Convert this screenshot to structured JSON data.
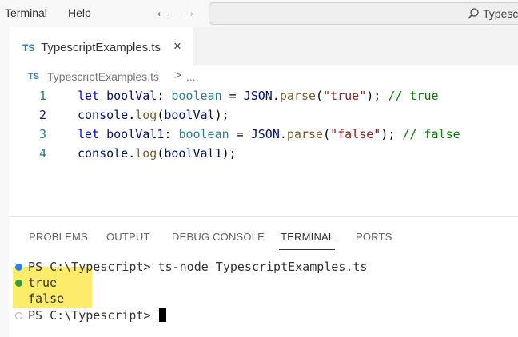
{
  "menu": {
    "terminal": "Terminal",
    "help": "Help"
  },
  "navigation": {
    "back_icon": "arrow-left-icon",
    "forward_icon": "arrow-right-icon"
  },
  "search": {
    "text": "Typesc",
    "icon": "search-icon"
  },
  "editor": {
    "tab": {
      "badge": "TS",
      "label": "TypescriptExamples.ts",
      "close": "×"
    },
    "breadcrumb": {
      "badge": "TS",
      "file": "TypescriptExamples.ts",
      "separator": ">",
      "more": "..."
    },
    "lines": [
      {
        "number": "1",
        "tokens": [
          {
            "text": "let",
            "kind": "kw"
          },
          {
            "text": " ",
            "kind": "plain"
          },
          {
            "text": "boolVal",
            "kind": "var"
          },
          {
            "text": ": ",
            "kind": "plain"
          },
          {
            "text": "boolean",
            "kind": "type"
          },
          {
            "text": " = ",
            "kind": "plain"
          },
          {
            "text": "JSON",
            "kind": "var"
          },
          {
            "text": ".",
            "kind": "plain"
          },
          {
            "text": "parse",
            "kind": "fn"
          },
          {
            "text": "(",
            "kind": "plain"
          },
          {
            "text": "\"true\"",
            "kind": "str"
          },
          {
            "text": "); ",
            "kind": "plain"
          },
          {
            "text": "// true",
            "kind": "cmt"
          }
        ]
      },
      {
        "number": "2",
        "tokens": [
          {
            "text": "console",
            "kind": "var"
          },
          {
            "text": ".",
            "kind": "plain"
          },
          {
            "text": "log",
            "kind": "fn"
          },
          {
            "text": "(",
            "kind": "plain"
          },
          {
            "text": "boolVal",
            "kind": "var"
          },
          {
            "text": ");",
            "kind": "plain"
          }
        ]
      },
      {
        "number": "3",
        "tokens": [
          {
            "text": "let",
            "kind": "kw"
          },
          {
            "text": " ",
            "kind": "plain"
          },
          {
            "text": "boolVal1",
            "kind": "var"
          },
          {
            "text": ": ",
            "kind": "plain"
          },
          {
            "text": "boolean",
            "kind": "type"
          },
          {
            "text": " = ",
            "kind": "plain"
          },
          {
            "text": "JSON",
            "kind": "var"
          },
          {
            "text": ".",
            "kind": "plain"
          },
          {
            "text": "parse",
            "kind": "fn"
          },
          {
            "text": "(",
            "kind": "plain"
          },
          {
            "text": "\"false\"",
            "kind": "str"
          },
          {
            "text": "); ",
            "kind": "plain"
          },
          {
            "text": "// false",
            "kind": "cmt"
          }
        ]
      },
      {
        "number": "4",
        "tokens": [
          {
            "text": "console",
            "kind": "var"
          },
          {
            "text": ".",
            "kind": "plain"
          },
          {
            "text": "log",
            "kind": "fn"
          },
          {
            "text": "(",
            "kind": "plain"
          },
          {
            "text": "boolVal1",
            "kind": "var"
          },
          {
            "text": ");",
            "kind": "plain"
          }
        ]
      }
    ],
    "active_line": "2"
  },
  "panel": {
    "tabs": [
      {
        "label": "PROBLEMS",
        "active": false
      },
      {
        "label": "OUTPUT",
        "active": false
      },
      {
        "label": "DEBUG CONSOLE",
        "active": false
      },
      {
        "label": "TERMINAL",
        "active": true
      },
      {
        "label": "PORTS",
        "active": false
      }
    ],
    "terminal_lines": [
      {
        "dot": "blue",
        "text": "PS C:\\Typescript> ts-node TypescriptExamples.ts"
      },
      {
        "dot": "green",
        "text": "true"
      },
      {
        "dot": "none",
        "text": "false"
      },
      {
        "dot": "hollow",
        "text": "PS C:\\Typescript> "
      }
    ],
    "highlight_color": "#fce94f"
  }
}
